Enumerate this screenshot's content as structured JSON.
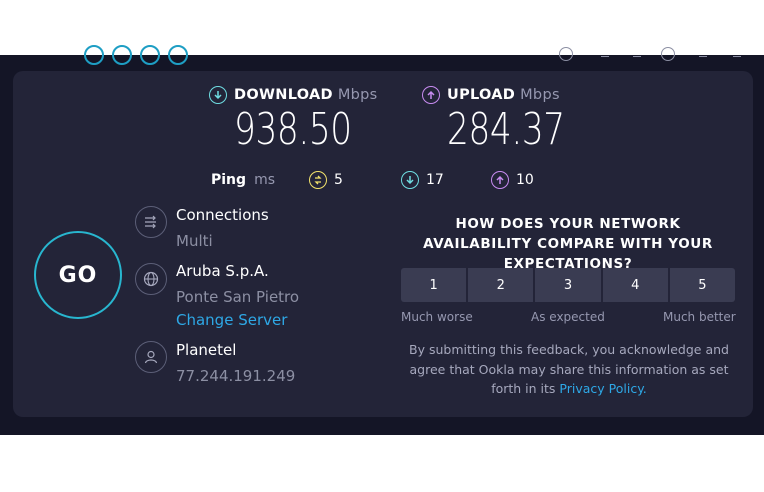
{
  "download": {
    "label": "DOWNLOAD",
    "unit": "Mbps",
    "value": "938.50",
    "color": "#6fdde2",
    "icon": "download-arrow-icon"
  },
  "upload": {
    "label": "UPLOAD",
    "unit": "Mbps",
    "value": "284.37",
    "color": "#c78bf0",
    "icon": "upload-arrow-icon"
  },
  "ping": {
    "label": "Ping",
    "unit": "ms",
    "idle": "5",
    "download": "17",
    "upload": "10"
  },
  "go_button": {
    "label": "GO",
    "color": "#28b6cf"
  },
  "connections": {
    "title": "Connections",
    "value": "Multi",
    "icon": "connections-icon"
  },
  "server": {
    "name": "Aruba S.p.A.",
    "location": "Ponte San Pietro",
    "change_label": "Change Server",
    "icon": "globe-icon"
  },
  "provider": {
    "name": "Planetel",
    "ip": "77.244.191.249",
    "icon": "user-icon"
  },
  "feedback": {
    "question": "HOW DOES YOUR NETWORK AVAILABILITY COMPARE WITH YOUR EXPECTATIONS?",
    "options": [
      "1",
      "2",
      "3",
      "4",
      "5"
    ],
    "scale_low": "Much worse",
    "scale_mid": "As expected",
    "scale_high": "Much better",
    "disclaimer_text": "By submitting this feedback, you acknowledge and agree that Ookla may share this information as set forth in its ",
    "privacy_link": "Privacy Policy."
  },
  "colors": {
    "background": "#141526",
    "panel": "#232438",
    "link": "#2ea8e6",
    "muted": "#8c8fa3"
  }
}
